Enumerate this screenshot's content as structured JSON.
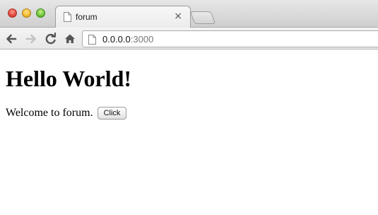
{
  "browser": {
    "tab": {
      "title": "forum",
      "close_glyph": "×"
    },
    "icons": {
      "back": "back-arrow-icon",
      "forward": "forward-arrow-icon",
      "reload": "reload-icon",
      "home": "home-icon",
      "page": "page-icon"
    },
    "omnibox": {
      "host": "0.0.0.0",
      "port": ":3000"
    }
  },
  "page": {
    "heading": "Hello World!",
    "welcome_text": "Welcome to forum.",
    "button_label": "Click"
  }
}
